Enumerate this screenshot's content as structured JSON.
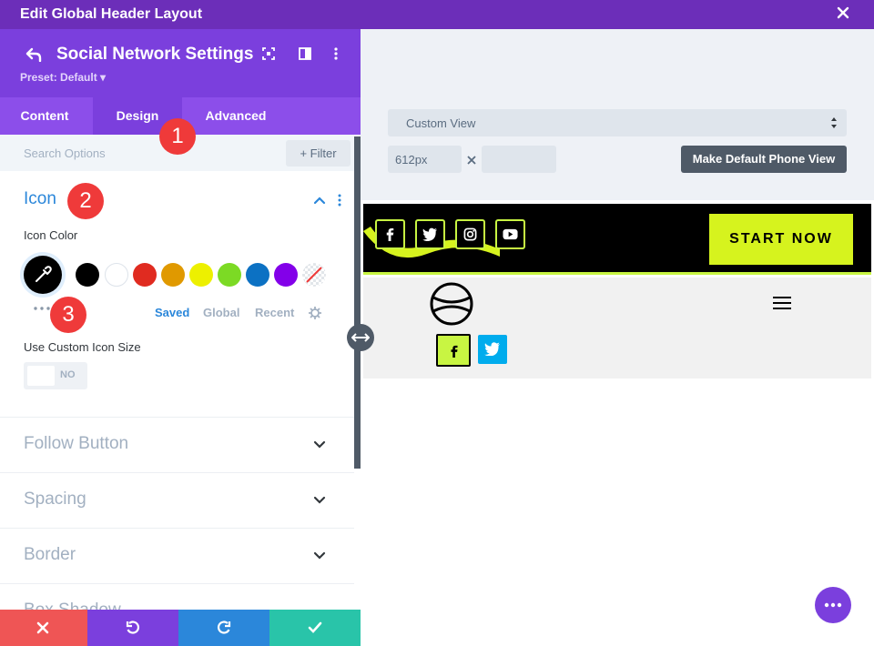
{
  "window": {
    "title": "Edit Global Header Layout"
  },
  "panel": {
    "title": "Social Network Settings",
    "preset": "Preset: Default ▾",
    "tabs": [
      "Content",
      "Design",
      "Advanced"
    ],
    "active_tab": "Design",
    "search_placeholder": "Search Options",
    "filter_label": "+ Filter"
  },
  "icon_section": {
    "title": "Icon",
    "icon_color_label": "Icon Color",
    "swatches": [
      "#000000",
      "#ffffff",
      "#e02b20",
      "#e09900",
      "#edf000",
      "#7cda24",
      "#0c71c3",
      "#8300e9"
    ],
    "palette_tabs": [
      "Saved",
      "Global",
      "Recent"
    ],
    "active_palette_tab": "Saved",
    "custom_size_label": "Use Custom Icon Size",
    "custom_size_value": "NO"
  },
  "collapsed_sections": [
    "Follow Button",
    "Spacing",
    "Border",
    "Box Shadow"
  ],
  "preview": {
    "view_select": "Custom View",
    "width_value": "612px",
    "height_value": "",
    "make_default_label": "Make Default Phone View",
    "cta_label": "START NOW"
  },
  "badges": [
    "1",
    "2",
    "3"
  ],
  "colors": {
    "top_bar": "#6c2eb9",
    "panel_header": "#7b3fdd",
    "accent_blue": "#2b87da",
    "lime": "#d6f31e",
    "cancel": "#ef5555",
    "undo": "#7b3fdd",
    "redo": "#2b87da",
    "save": "#29c4a9"
  }
}
